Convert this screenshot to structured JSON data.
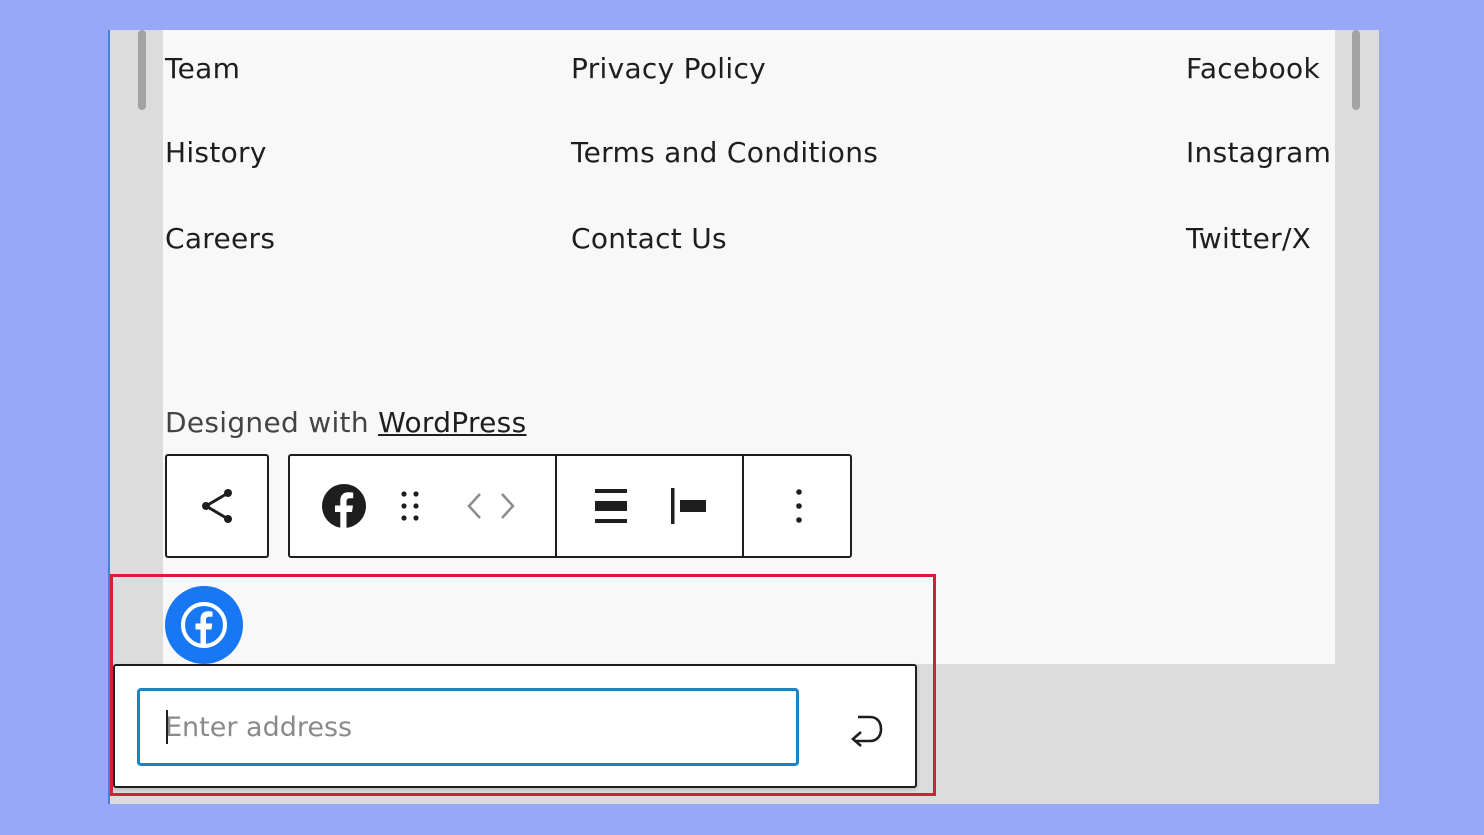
{
  "footer_nav": {
    "column1": [
      "Team",
      "History",
      "Careers"
    ],
    "column2": [
      "Privacy Policy",
      "Terms and Conditions",
      "Contact Us"
    ],
    "column3": [
      "Facebook",
      "Instagram",
      "Twitter/X"
    ]
  },
  "credit": {
    "prefix": "Designed with ",
    "link": "WordPress"
  },
  "toolbar": {
    "icons": [
      "share-icon",
      "facebook-icon",
      "drag-handle-icon",
      "chevron-left-icon",
      "chevron-right-icon",
      "justify-icon",
      "align-left-icon",
      "more-options-icon"
    ]
  },
  "link_popover": {
    "placeholder": "Enter address",
    "value": "",
    "submit_icon": "enter-return-icon"
  },
  "colors": {
    "background": "#97a8f9",
    "facebook_brand": "#1877f2",
    "input_focus": "#1a84c5",
    "highlight_border": "#d0203a"
  }
}
